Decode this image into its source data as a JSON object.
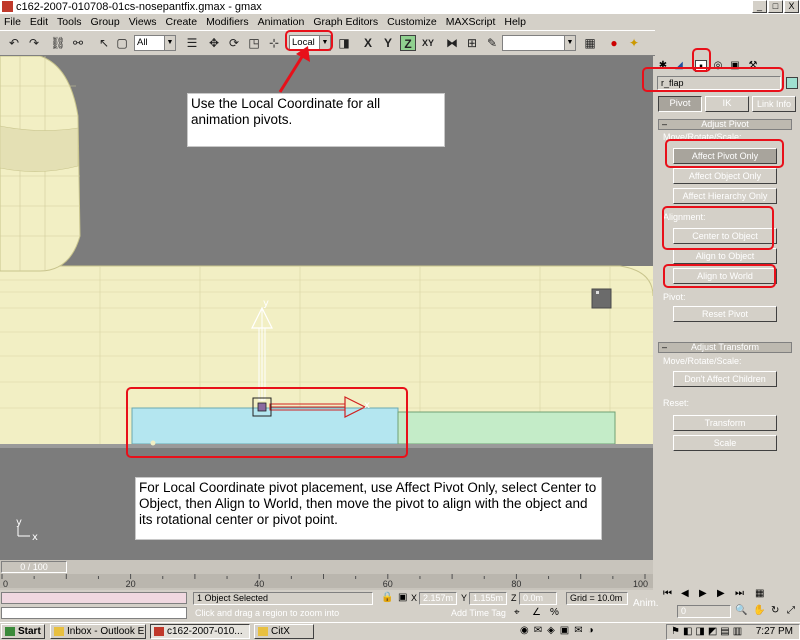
{
  "window": {
    "title": "c162-2007-010708-01cs-nosepantfix.gmax - gmax",
    "minimize": "_",
    "maximize": "□",
    "close": "X"
  },
  "menu": [
    "File",
    "Edit",
    "Tools",
    "Group",
    "Views",
    "Create",
    "Modifiers",
    "Animation",
    "Graph Editors",
    "Customize",
    "MAXScript",
    "Help"
  ],
  "toolbar": {
    "selection_filter": "All",
    "coordinate_system": "Local",
    "axis_labels": [
      "X",
      "Y",
      "Z",
      "XY"
    ]
  },
  "viewport": {
    "axis_y": "y",
    "axis_x": "x",
    "corner_y": "y",
    "corner_x": "x"
  },
  "annotations": {
    "top": "Use the Local Coordinate for all animation pivots.",
    "bottom": "For Local Coordinate pivot placement, use Affect Pivot Only, select Center to Object, then Align to World, then move the pivot to align with the object and its rotational center or pivot point."
  },
  "command_panel": {
    "object_name": "r_flap",
    "object_color": "#9fe0d0",
    "tabs": [
      "Pivot",
      "IK",
      "Link Info"
    ],
    "adjust_pivot": {
      "header": "Adjust Pivot",
      "move_group": "Move/Rotate/Scale:",
      "affect_pivot_only": "Affect Pivot Only",
      "affect_object_only": "Affect Object Only",
      "affect_hierarchy_only": "Affect Hierarchy Only",
      "alignment_group": "Alignment:",
      "center_to_object": "Center to Object",
      "align_to_object": "Align to Object",
      "align_to_world": "Align to World",
      "pivot_group": "Pivot:",
      "reset_pivot": "Reset Pivot"
    },
    "adjust_transform": {
      "header": "Adjust Transform",
      "move_group": "Move/Rotate/Scale:",
      "dont_affect_children": "Don't Affect Children",
      "reset_group": "Reset:",
      "transform": "Transform",
      "scale": "Scale"
    }
  },
  "timeline": {
    "frame_display": "0 / 100",
    "ticks": [
      "0",
      "20",
      "40",
      "60",
      "80",
      "100"
    ]
  },
  "status": {
    "selection": "1 Object Selected",
    "prompt": "Click and drag a region to zoom into",
    "x_label": "X",
    "x_value": "2.157m",
    "y_label": "Y",
    "y_value": "1.155m",
    "z_label": "Z",
    "z_value": "0.0m",
    "grid": "Grid = 10.0m",
    "add_time_tag": "Add Time Tag",
    "anim": "Anim.",
    "frame_value": "0"
  },
  "taskbar": {
    "start": "Start",
    "tasks": [
      "Inbox - Outlook E...",
      "c162-2007-010...",
      "CitX"
    ],
    "clock": "7:27 PM"
  },
  "colors": {
    "highlight": "#e8101a",
    "fuselage": "#f2efc4",
    "flap": "#b4e6f0",
    "aileron": "#c4ecc8"
  }
}
